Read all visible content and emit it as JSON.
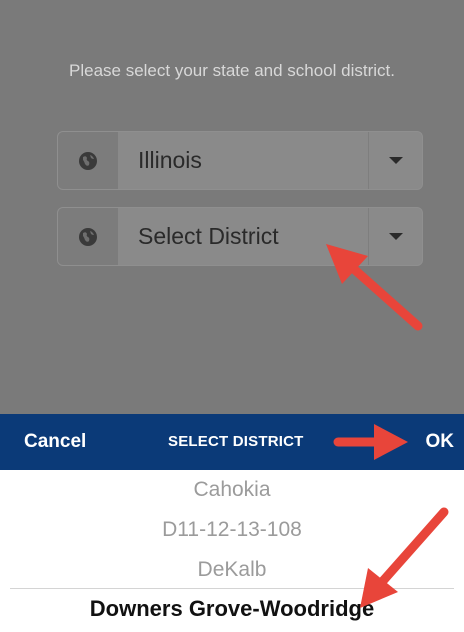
{
  "prompt": "Please select your state and school district.",
  "state_select": {
    "value": "Illinois",
    "icon": "globe-icon",
    "caret": "chevron-down-icon"
  },
  "district_select": {
    "value": "Select District",
    "icon": "globe-icon",
    "caret": "chevron-down-icon"
  },
  "toolbar": {
    "cancel_label": "Cancel",
    "title": "SELECT DISTRICT",
    "ok_label": "OK",
    "background": "#0b3a78"
  },
  "picker": {
    "items": [
      "Cahokia",
      "D11-12-13-108",
      "DeKalb",
      "Downers Grove-Woodridge"
    ],
    "selected": "Downers Grove-Woodridge"
  },
  "colors": {
    "annotation_arrow": "#e8453a",
    "overlay": "#7a7a7a"
  }
}
